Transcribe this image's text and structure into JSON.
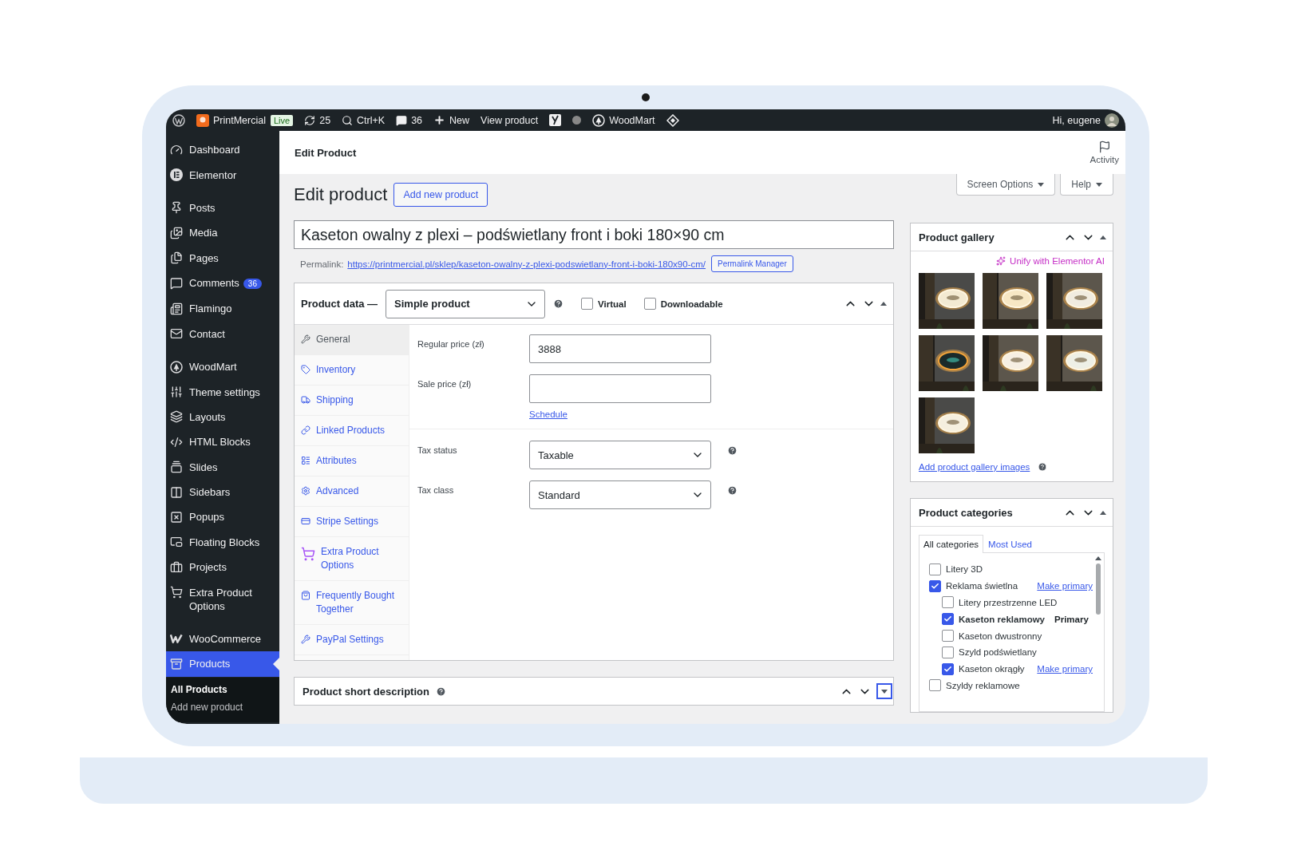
{
  "admin_bar": {
    "site": "PrintMercial",
    "live": "Live",
    "updates": "25",
    "search": "Ctrl+K",
    "comments": "36",
    "new": "New",
    "view": "View product",
    "woodmart": "WoodMart",
    "greeting": "Hi, eugene"
  },
  "sidebar": {
    "sections": [
      [
        {
          "label": "Dashboard",
          "selected": false
        },
        {
          "label": "Elementor",
          "selected": false
        }
      ],
      [
        {
          "label": "Posts",
          "selected": false
        },
        {
          "label": "Media",
          "selected": false
        },
        {
          "label": "Pages",
          "selected": false
        },
        {
          "label": "Comments",
          "badge": "36",
          "selected": false
        },
        {
          "label": "Flamingo",
          "selected": false
        },
        {
          "label": "Contact",
          "selected": false
        }
      ],
      [
        {
          "label": "WoodMart",
          "selected": false
        },
        {
          "label": "Theme settings",
          "selected": false
        },
        {
          "label": "Layouts",
          "selected": false
        },
        {
          "label": "HTML Blocks",
          "selected": false
        },
        {
          "label": "Slides",
          "selected": false
        },
        {
          "label": "Sidebars",
          "selected": false
        },
        {
          "label": "Popups",
          "selected": false
        },
        {
          "label": "Floating Blocks",
          "selected": false
        },
        {
          "label": "Projects",
          "selected": false
        },
        {
          "label": "Extra Product Options",
          "selected": false
        }
      ],
      [
        {
          "label": "WooCommerce",
          "selected": false
        },
        {
          "label": "Products",
          "selected": true
        }
      ]
    ],
    "submenu": [
      {
        "label": "All Products",
        "selected": true
      },
      {
        "label": "Add new product",
        "selected": false
      }
    ]
  },
  "header": {
    "title": "Edit Product",
    "activity": "Activity"
  },
  "help_tabs": [
    "Screen Options",
    "Help"
  ],
  "page_title": "Edit product",
  "add_new": "Add new product",
  "product_title": "Kaseton owalny z plexi – podświetlany front i boki 180×90 cm",
  "permalink": {
    "label": "Permalink:",
    "url": "https://printmercial.pl/sklep/kaseton-owalny-z-plexi-podswietlany-front-i-boki-180x90-cm/",
    "button": "Permalink Manager"
  },
  "product_data": {
    "label": "Product data —",
    "type": "Simple product",
    "options": [
      {
        "label": "Virtual",
        "checked": false
      },
      {
        "label": "Downloadable",
        "checked": false
      }
    ],
    "tabs": [
      {
        "label": "General",
        "selected": true
      },
      {
        "label": "Inventory",
        "selected": false
      },
      {
        "label": "Shipping",
        "selected": false
      },
      {
        "label": "Linked Products",
        "selected": false
      },
      {
        "label": "Attributes",
        "selected": false
      },
      {
        "label": "Advanced",
        "selected": false
      },
      {
        "label": "Stripe Settings",
        "selected": false
      },
      {
        "label": "Extra Product Options",
        "selected": false
      },
      {
        "label": "Frequently Bought Together",
        "selected": false
      },
      {
        "label": "PayPal Settings",
        "selected": false
      }
    ],
    "price_fields": [
      {
        "label": "Regular price (zł)",
        "value": "3888"
      },
      {
        "label": "Sale price (zł)",
        "link": "Schedule"
      }
    ],
    "tax_fields": [
      {
        "label": "Tax status",
        "value": "Taxable"
      },
      {
        "label": "Tax class",
        "value": "Standard"
      }
    ]
  },
  "short_description": {
    "title": "Product short description"
  },
  "gallery": {
    "title": "Product gallery",
    "ai_link": "Unify with Elementor AI",
    "add_link": "Add product gallery images"
  },
  "categories": {
    "title": "Product categories",
    "tabs": [
      {
        "label": "All categories",
        "selected": true
      },
      {
        "label": "Most Used",
        "selected": false
      }
    ],
    "items": [
      {
        "label": "Litery 3D",
        "checked": false
      },
      {
        "label": "Reklama świetlna",
        "checked": true,
        "action": "Make primary",
        "children": [
          {
            "label": "Litery przestrzenne LED",
            "checked": false
          },
          {
            "label": "Kaseton reklamowy",
            "checked": true,
            "primary": true,
            "tag": "Primary"
          },
          {
            "label": "Kaseton dwustronny",
            "checked": false
          },
          {
            "label": "Szyld podświetlany",
            "checked": false
          },
          {
            "label": "Kaseton okrągły",
            "checked": true,
            "action": "Make primary"
          }
        ]
      },
      {
        "label": "Szyldy reklamowe",
        "checked": false
      }
    ]
  }
}
